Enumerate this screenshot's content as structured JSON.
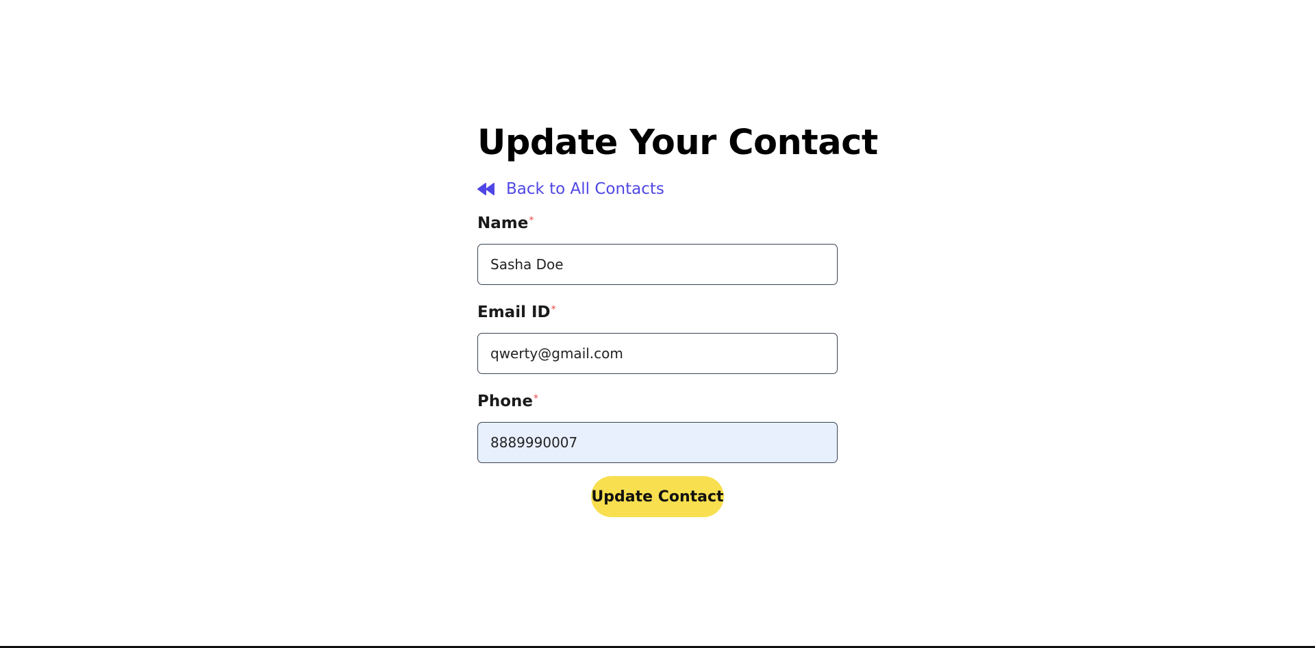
{
  "page": {
    "title": "Update Your Contact"
  },
  "back_link": {
    "label": "Back to All Contacts",
    "icon": "backward-icon",
    "color": "#4f46e5"
  },
  "form": {
    "fields": [
      {
        "label": "Name",
        "required_marker": "*",
        "value": "Sasha Doe"
      },
      {
        "label": "Email ID",
        "required_marker": "*",
        "value": "qwerty@gmail.com"
      },
      {
        "label": "Phone",
        "required_marker": "*",
        "value": "8889990007"
      }
    ],
    "submit_label": "Update Contact",
    "submit_color": "#f8df4f",
    "required_color": "#ef4444"
  }
}
